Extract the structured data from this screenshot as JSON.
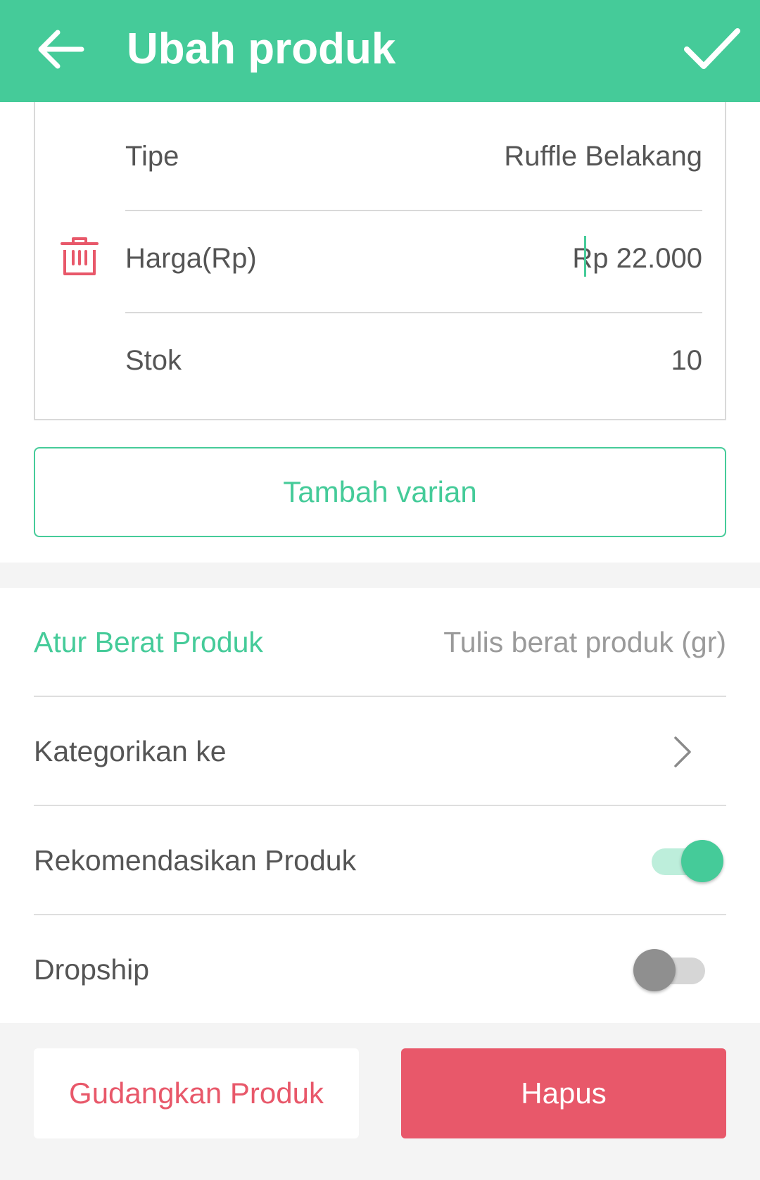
{
  "appbar": {
    "title": "Ubah produk",
    "back_icon": "arrow-left-icon",
    "confirm_icon": "check-icon",
    "color": "#45cb99"
  },
  "variant": {
    "type_label": "Tipe",
    "type_value": "Ruffle Belakang",
    "price_label": "Harga(Rp)",
    "price_value": "Rp 22.000",
    "stock_label": "Stok",
    "stock_value": "10",
    "delete_icon": "trash-icon"
  },
  "add_variant_label": "Tambah varian",
  "settings": {
    "weight_label": "Atur Berat Produk",
    "weight_placeholder": "Tulis berat produk (gr)",
    "category_label": "Kategorikan ke",
    "recommend_label": "Rekomendasikan Produk",
    "recommend_on": true,
    "dropship_label": "Dropship",
    "dropship_on": false
  },
  "actions": {
    "store_label": "Gudangkan Produk",
    "delete_label": "Hapus",
    "danger_color": "#e8586a"
  }
}
